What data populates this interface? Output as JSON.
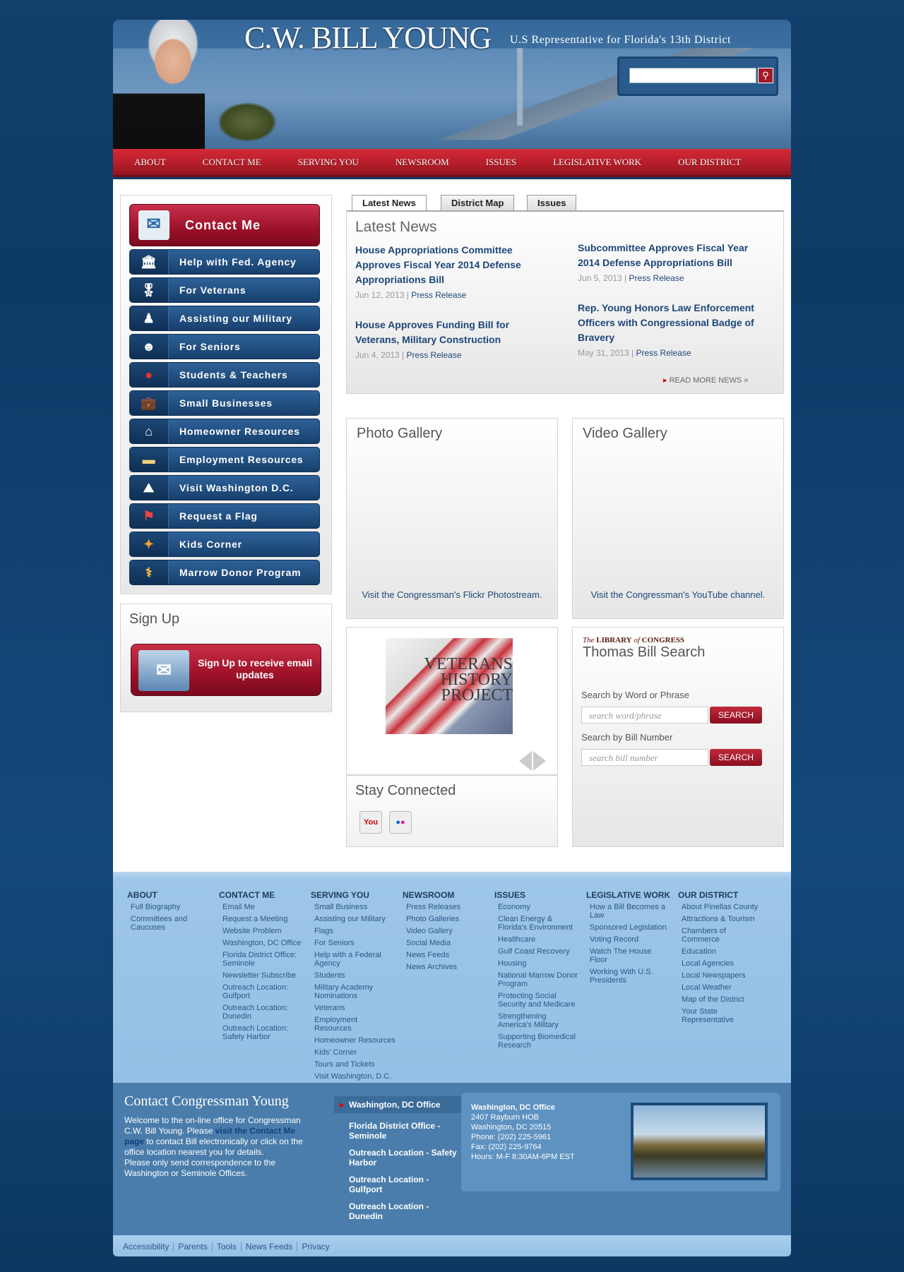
{
  "header": {
    "title": "C.W. BILL YOUNG",
    "subtitle": "U.S Representative for Florida's 13th District",
    "search_placeholder": ""
  },
  "nav": [
    "ABOUT",
    "CONTACT ME",
    "SERVING YOU",
    "NEWSROOM",
    "ISSUES",
    "LEGISLATIVE WORK",
    "OUR DISTRICT"
  ],
  "sidebar": {
    "contact_me": "Contact Me",
    "items": [
      {
        "label": "Help with Fed. Agency",
        "icon": "building-icon"
      },
      {
        "label": "For Veterans",
        "icon": "medal-icon"
      },
      {
        "label": "Assisting our Military",
        "icon": "soldier-icon"
      },
      {
        "label": "For Seniors",
        "icon": "senior-icon"
      },
      {
        "label": "Students & Teachers",
        "icon": "apple-icon"
      },
      {
        "label": "Small Businesses",
        "icon": "briefcase-icon"
      },
      {
        "label": "Homeowner Resources",
        "icon": "house-icon"
      },
      {
        "label": "Employment Resources",
        "icon": "folder-icon"
      },
      {
        "label": "Visit Washington D.C.",
        "icon": "capitol-icon"
      },
      {
        "label": "Request a Flag",
        "icon": "flag-icon"
      },
      {
        "label": "Kids Corner",
        "icon": "puzzle-icon"
      },
      {
        "label": "Marrow Donor Program",
        "icon": "caduceus-icon"
      }
    ]
  },
  "signup": {
    "title": "Sign Up",
    "button": "Sign Up to receive email updates"
  },
  "news": {
    "tabs": [
      "Latest News",
      "District Map",
      "Issues"
    ],
    "heading": "Latest News",
    "items": [
      {
        "title": "House Appropriations Committee Approves Fiscal Year 2014 Defense Appropriations Bill",
        "date": "Jun 12, 2013",
        "type": "Press Release"
      },
      {
        "title": "House Approves Funding Bill for Veterans, Military Construction",
        "date": "Jun 4, 2013",
        "type": "Press Release"
      },
      {
        "title": "Subcommittee Approves Fiscal Year 2014 Defense Appropriations Bill",
        "date": "Jun 5, 2013",
        "type": "Press Release"
      },
      {
        "title": "Rep. Young Honors Law Enforcement Officers with Congressional Badge of Bravery",
        "date": "May 31, 2013",
        "type": "Press Release"
      }
    ],
    "more": "READ MORE NEWS »"
  },
  "photo_gallery": {
    "title": "Photo Gallery",
    "caption": "Visit the Congressman's Flickr Photostream."
  },
  "video_gallery": {
    "title": "Video Gallery",
    "caption": "Visit the Congressman's YouTube channel."
  },
  "vhp": {
    "text": "VETERANS HISTORY PROJECT"
  },
  "stay": {
    "title": "Stay Connected",
    "icons": [
      "youtube-icon",
      "flickr-icon"
    ]
  },
  "thomas": {
    "loc_prefix": "The",
    "loc_main": "LIBRARY",
    "loc_of": "of",
    "loc_end": "CONGRESS",
    "title": "Thomas Bill Search",
    "word_label": "Search by Word or Phrase",
    "word_placeholder": "search word/phrase",
    "bill_label": "Search by Bill Number",
    "bill_placeholder": "search bill number",
    "button": "SEARCH"
  },
  "footer": {
    "columns": [
      {
        "heading": "ABOUT",
        "links": [
          "Full Biography",
          "Committees and Caucuses"
        ]
      },
      {
        "heading": "CONTACT ME",
        "links": [
          "Email Me",
          "Request a Meeting",
          "Website Problem",
          "Washington, DC Office",
          "Florida District Office: Seminole",
          "Newsletter Subscribe",
          "Outreach Location: Gulfport",
          "Outreach Location: Dunedin",
          "Outreach Location: Safety Harbor"
        ]
      },
      {
        "heading": "SERVING YOU",
        "links": [
          "Small Business",
          "Assisting our Military",
          "Flags",
          "For Seniors",
          "Help with a Federal Agency",
          "Students",
          "Military Academy Nominations",
          "Veterans",
          "Employment Resources",
          "Homeowner Resources",
          "Kids' Corner",
          "Tours and Tickets",
          "Visit Washington, D.C."
        ]
      },
      {
        "heading": "NEWSROOM",
        "links": [
          "Press Releases",
          "Photo Galleries",
          "Video Gallery",
          "Social Media",
          "News Feeds",
          "News Archives"
        ]
      },
      {
        "heading": "ISSUES",
        "links": [
          "Economy",
          "Clean Energy & Florida's Environment",
          "Healthcare",
          "Gulf Coast Recovery",
          "Housing",
          "National Marrow Donor Program",
          "Protecting Social Security and Medicare",
          "Strengthening America's Military",
          "Supporting Biomedical Research"
        ]
      },
      {
        "heading": "LEGISLATIVE WORK",
        "links": [
          "How a Bill Becomes a Law",
          "Sponsored Legislation",
          "Voting Record",
          "Watch The House Floor",
          "Working With U.S. Presidents"
        ]
      },
      {
        "heading": "OUR DISTRICT",
        "links": [
          "About Pinellas County",
          "Attractions & Tourism",
          "Chambers of Commerce",
          "Education",
          "Local Agencies",
          "Local Newspapers",
          "Local Weather",
          "Map of the District",
          "Your State Representative"
        ]
      }
    ]
  },
  "contact": {
    "title": "Contact Congressman Young",
    "text1": "Welcome to the on-line office for Congressman C.W. Bill Young. Please ",
    "link": "visit the Contact Me page",
    "text2": " to contact Bill electronically or click on the office location nearest you for details.",
    "text3": "Please only send correspondence to the Washington or Seminole Offices.",
    "locations": [
      "Washington, DC Office",
      "Florida District Office - Seminole",
      "Outreach Location - Safety Harbor",
      "Outreach Location - Gulfport",
      "Outreach Location - Dunedin"
    ],
    "address": {
      "office": "Washington, DC Office",
      "line1": "2407 Rayburn HOB",
      "line2": "Washington, DC 20515",
      "phone": "Phone: (202) 225-5961",
      "fax": "Fax: (202) 225-9764",
      "hours": "Hours: M-F 8:30AM-6PM EST"
    }
  },
  "bottom_links": [
    "Accessibility",
    "Parents",
    "Tools",
    "News Feeds",
    "Privacy"
  ],
  "colors": {
    "nav_red": "#b41d2a",
    "link_blue": "#1d4678",
    "footer_blue": "#95c0e5"
  }
}
